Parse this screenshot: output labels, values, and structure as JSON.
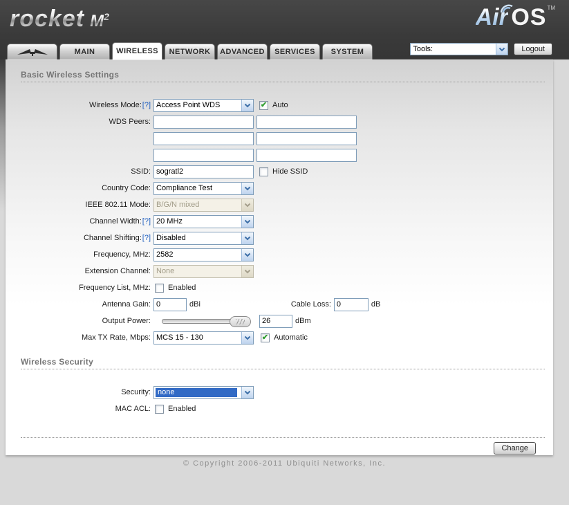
{
  "header": {
    "brand_left": {
      "word": "rocket",
      "model": "M",
      "model_sup": "2"
    },
    "brand_right": {
      "air": "Air",
      "os": "OS",
      "tm": "TM"
    },
    "tools_select": {
      "value": "Tools:"
    },
    "logout_label": "Logout"
  },
  "tabs": [
    {
      "label": "",
      "icon": "ubiquiti-antenna-icon",
      "active": false
    },
    {
      "label": "MAIN",
      "active": false
    },
    {
      "label": "WIRELESS",
      "active": true
    },
    {
      "label": "NETWORK",
      "active": false
    },
    {
      "label": "ADVANCED",
      "active": false
    },
    {
      "label": "SERVICES",
      "active": false
    },
    {
      "label": "SYSTEM",
      "active": false
    }
  ],
  "sections": {
    "basic": {
      "title": "Basic Wireless Settings"
    },
    "security": {
      "title": "Wireless Security"
    }
  },
  "fields": {
    "wireless_mode": {
      "label": "Wireless Mode:",
      "help": "[?]",
      "value": "Access Point WDS",
      "auto_label": "Auto",
      "auto_checked": true
    },
    "wds_peers": {
      "label": "WDS Peers:",
      "values": [
        "",
        "",
        "",
        "",
        "",
        ""
      ]
    },
    "ssid": {
      "label": "SSID:",
      "value": "sogratl2",
      "hide_label": "Hide SSID",
      "hide_checked": false
    },
    "country_code": {
      "label": "Country Code:",
      "value": "Compliance Test"
    },
    "ieee_mode": {
      "label": "IEEE 802.11 Mode:",
      "value": "B/G/N mixed",
      "disabled": true
    },
    "channel_width": {
      "label": "Channel Width:",
      "help": "[?]",
      "value": "20 MHz"
    },
    "channel_shifting": {
      "label": "Channel Shifting:",
      "help": "[?]",
      "value": "Disabled"
    },
    "frequency": {
      "label": "Frequency, MHz:",
      "value": "2582"
    },
    "extension_channel": {
      "label": "Extension Channel:",
      "value": "None",
      "disabled": true
    },
    "frequency_list": {
      "label": "Frequency List, MHz:",
      "enabled_label": "Enabled",
      "checked": false
    },
    "antenna_gain": {
      "label": "Antenna Gain:",
      "value": "0",
      "unit": "dBi"
    },
    "cable_loss": {
      "label": "Cable Loss:",
      "value": "0",
      "unit": "dB"
    },
    "output_power": {
      "label": "Output Power:",
      "value": "26",
      "unit": "dBm",
      "slider_percent": 100
    },
    "max_tx_rate": {
      "label": "Max TX Rate, Mbps:",
      "value": "MCS 15 - 130",
      "auto_label": "Automatic",
      "auto_checked": true
    },
    "security": {
      "label": "Security:",
      "value": "none",
      "highlighted": true
    },
    "mac_acl": {
      "label": "MAC ACL:",
      "enabled_label": "Enabled",
      "checked": false
    }
  },
  "footer": {
    "change_label": "Change",
    "copyright": "© Copyright 2006-2011 Ubiquiti Networks, Inc."
  },
  "colors": {
    "header_bg": "#3a3a3a",
    "accent_blue": "#316ac5",
    "select_border": "#7f9db9",
    "check_green": "#2f9e2f",
    "help_link": "#1f5fc0",
    "airos_blue": "#86aed6"
  }
}
